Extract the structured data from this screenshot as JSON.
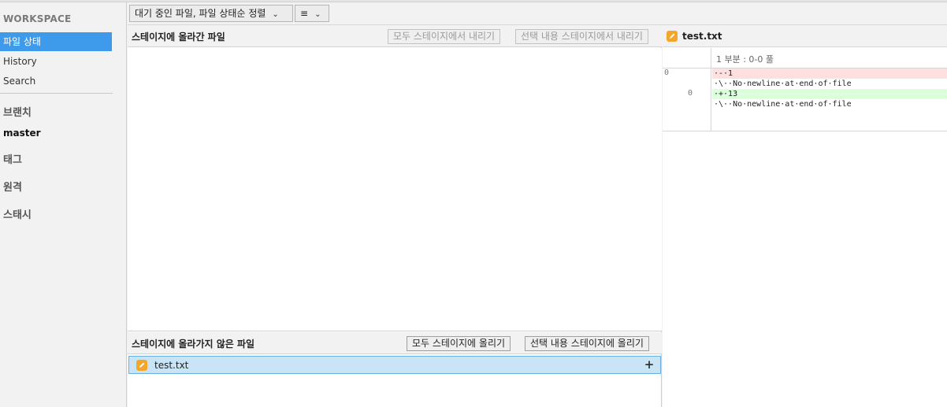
{
  "sidebar": {
    "section_title": "WORKSPACE",
    "items": [
      {
        "label": "파일 상태",
        "selected": true
      },
      {
        "label": "History",
        "selected": false
      },
      {
        "label": "Search",
        "selected": false
      }
    ],
    "groups": {
      "branches": "브랜치",
      "current_branch": "master",
      "tags": "태그",
      "remotes": "원격",
      "stashes": "스태시"
    }
  },
  "toolbar": {
    "sort_dropdown": "대기 중인 파일, 파일 상태순 정렬",
    "view_dropdown": "≡"
  },
  "staged": {
    "title": "스테이지에 올라간 파일",
    "unstage_all": "모두 스테이지에서 내리기",
    "unstage_selected": "선택 내용 스테이지에서 내리기"
  },
  "unstaged": {
    "title": "스테이지에 올라가지 않은 파일",
    "stage_all": "모두 스테이지에 올리기",
    "stage_selected": "선택 내용 스테이지에 올리기",
    "files": [
      {
        "name": "test.txt",
        "status": "modified"
      }
    ]
  },
  "diff": {
    "file_name": "test.txt",
    "hunk_header": "1 부분 : 0-0 풀",
    "lines": [
      {
        "old": "0",
        "new": "",
        "type": "del",
        "text": "·-·1"
      },
      {
        "old": "",
        "new": "",
        "type": "ctx",
        "text": "·\\··No·newline·at·end·of·file"
      },
      {
        "old": "",
        "new": "0",
        "type": "add",
        "text": "·+·13"
      },
      {
        "old": "",
        "new": "",
        "type": "ctx",
        "text": "·\\··No·newline·at·end·of·file"
      }
    ]
  },
  "colors": {
    "selection_blue": "#3e9bec",
    "file_row_bg": "#c9e4f4",
    "modified_icon": "#f4a62a",
    "diff_del_bg": "#ffe0e0",
    "diff_add_bg": "#dcffdc"
  }
}
